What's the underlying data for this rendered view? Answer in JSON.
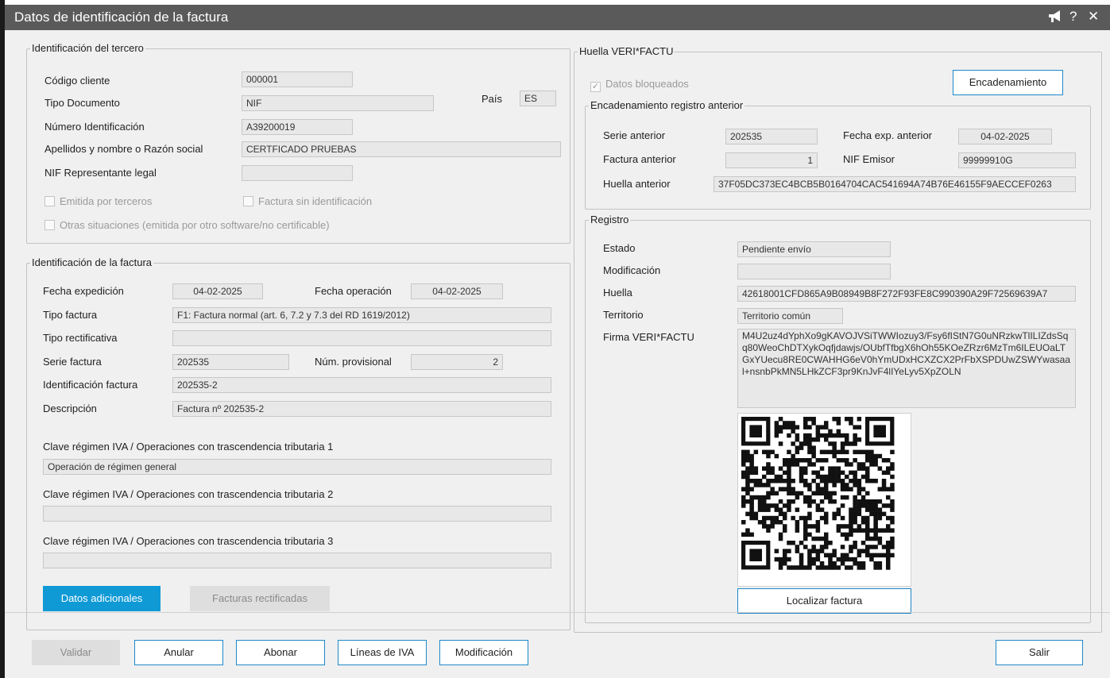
{
  "window": {
    "title": "Datos de identificación de la factura",
    "help_glyph": "?",
    "close_glyph": "✕"
  },
  "tercero": {
    "title": "Identificación del tercero",
    "codigo_label": "Código cliente",
    "codigo_value": "000001",
    "tipo_doc_label": "Tipo Documento",
    "tipo_doc_value": "NIF",
    "pais_label": "País",
    "pais_value": "ES",
    "num_ident_label": "Número Identificación",
    "num_ident_value": "A39200019",
    "razon_label": "Apellidos y nombre o Razón social",
    "razon_value": "CERTFICADO PRUEBAS",
    "nif_rep_label": "NIF Representante legal",
    "nif_rep_value": "",
    "emitida_terceros": "Emitida por terceros",
    "sin_ident": "Factura sin identificación",
    "otras_situaciones": "Otras situaciones (emitida por otro software/no certificable)"
  },
  "factura": {
    "title": "Identificación de la factura",
    "fecha_exp_label": "Fecha expedición",
    "fecha_exp_value": "04-02-2025",
    "fecha_op_label": "Fecha operación",
    "fecha_op_value": "04-02-2025",
    "tipo_label": "Tipo factura",
    "tipo_value": "F1: Factura normal (art. 6, 7.2 y 7.3 del RD 1619/2012)",
    "tipo_rect_label": "Tipo rectificativa",
    "tipo_rect_value": "",
    "serie_label": "Serie factura",
    "serie_value": "202535",
    "num_prov_label": "Núm. provisional",
    "num_prov_value": "2",
    "ident_label": "Identificación factura",
    "ident_value": "202535-2",
    "desc_label": "Descripción",
    "desc_value": "Factura nº 202535-2",
    "clave1_label": "Clave régimen IVA / Operaciones con trascendencia tributaria 1",
    "clave1_value": "Operación de régimen general",
    "clave2_label": "Clave régimen IVA / Operaciones con trascendencia tributaria 2",
    "clave2_value": "",
    "clave3_label": "Clave régimen IVA / Operaciones con trascendencia tributaria 3",
    "clave3_value": "",
    "datos_adicionales": "Datos adicionales",
    "facturas_rectificadas": "Facturas rectificadas"
  },
  "huella": {
    "title": "Huella VERI*FACTU",
    "datos_bloqueados": "Datos bloqueados",
    "encadenamiento_button": "Encadenamiento",
    "anterior": {
      "title": "Encadenamiento registro anterior",
      "serie_label": "Serie anterior",
      "serie_value": "202535",
      "fecha_label": "Fecha exp. anterior",
      "fecha_value": "04-02-2025",
      "factura_label": "Factura anterior",
      "factura_value": "1",
      "nif_label": "NIF Emisor",
      "nif_value": "99999910G",
      "huella_label": "Huella anterior",
      "huella_value": "37F05DC373EC4BCB5B0164704CAC541694A74B76E46155F9AECCEF0263"
    },
    "registro": {
      "title": "Registro",
      "estado_label": "Estado",
      "estado_value": "Pendiente envío",
      "modif_label": "Modificación",
      "modif_value": "",
      "huella_label": "Huella",
      "huella_value": "42618001CFD865A9B08949B8F272F93FE8C990390A29F72569639A7",
      "territorio_label": "Territorio",
      "territorio_value": "Territorio común",
      "firma_label": "Firma VERI*FACTU",
      "firma_value": "M4U2uz4dYphXo9gKAVOJVSiTWWIozuy3/Fsy6fIStN7G0uNRzkwTlILIZdsSqq80WeoChDTXykOqfjdawjs/OUbfTfbgX6hOh55KOeZRzr6MzTm6ILEUOaLTGxYUecu8RE0CWAHHG6eV0hYmUDxHCXZCX2PrFbXSPDUwZSWYwasaal+nsnbPkMN5LHkZCF3pr9KnJvF4lIYeLyv5XpZOLN",
      "localizar_button": "Localizar factura"
    }
  },
  "footer": {
    "validar": "Validar",
    "anular": "Anular",
    "abonar": "Abonar",
    "lineas_iva": "Líneas de IVA",
    "modificacion": "Modificación",
    "salir": "Salir"
  }
}
